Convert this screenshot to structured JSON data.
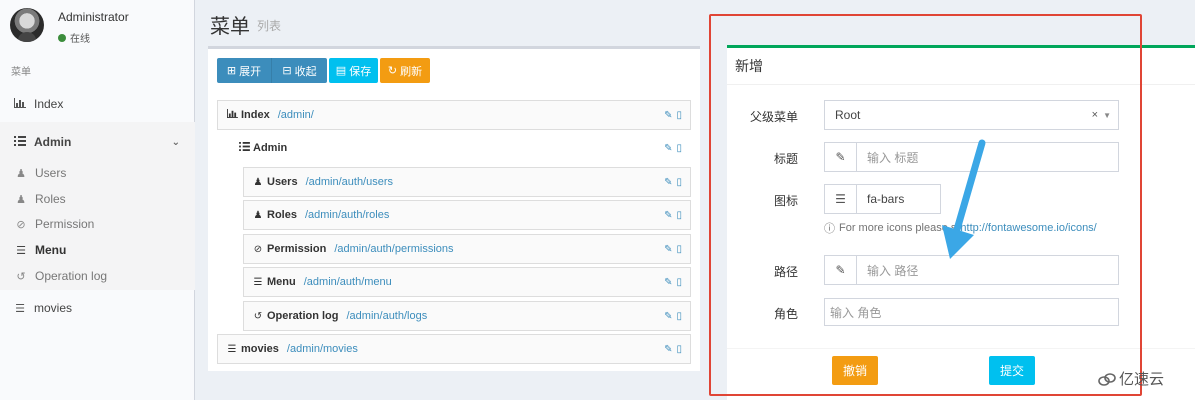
{
  "user": {
    "name": "Administrator",
    "status": "在线"
  },
  "sidebar": {
    "header": "菜单",
    "items": [
      {
        "label": "Index",
        "icon": "bar-chart-icon"
      },
      {
        "label": "Admin",
        "icon": "tasks-icon"
      },
      {
        "label": "movies",
        "icon": "bars-icon"
      }
    ],
    "admin_children": [
      {
        "label": "Users",
        "icon": "users-icon"
      },
      {
        "label": "Roles",
        "icon": "user-icon"
      },
      {
        "label": "Permission",
        "icon": "ban-icon"
      },
      {
        "label": "Menu",
        "icon": "bars-icon"
      },
      {
        "label": "Operation log",
        "icon": "history-icon"
      }
    ]
  },
  "page": {
    "title": "菜单",
    "subtitle": "列表"
  },
  "toolbar": {
    "expand": "展开",
    "collapse": "收起",
    "save": "保存",
    "refresh": "刷新"
  },
  "tree": [
    {
      "name": "Index",
      "uri": "/admin/"
    },
    {
      "name": "Admin",
      "uri": ""
    },
    {
      "name": "Users",
      "uri": "/admin/auth/users"
    },
    {
      "name": "Roles",
      "uri": "/admin/auth/roles"
    },
    {
      "name": "Permission",
      "uri": "/admin/auth/permissions"
    },
    {
      "name": "Menu",
      "uri": "/admin/auth/menu"
    },
    {
      "name": "Operation log",
      "uri": "/admin/auth/logs"
    },
    {
      "name": "movies",
      "uri": "/admin/movies"
    }
  ],
  "form": {
    "title": "新增",
    "parent_label": "父级菜单",
    "parent_value": "Root",
    "title_label": "标题",
    "title_placeholder": "输入 标题",
    "icon_label": "图标",
    "icon_value": "fa-bars",
    "icon_help": "For more icons please s",
    "icon_help_link": "http://fontawesome.io/icons/",
    "uri_label": "路径",
    "uri_placeholder": "输入 路径",
    "roles_label": "角色",
    "roles_placeholder": "输入 角色",
    "reset": "撤销",
    "submit": "提交"
  },
  "watermark": "亿速云",
  "colors": {
    "primary": "#3c8dbc",
    "info": "#00c0ef",
    "warning": "#f39c12",
    "success": "#00a65a",
    "highlight": "#e04535"
  }
}
